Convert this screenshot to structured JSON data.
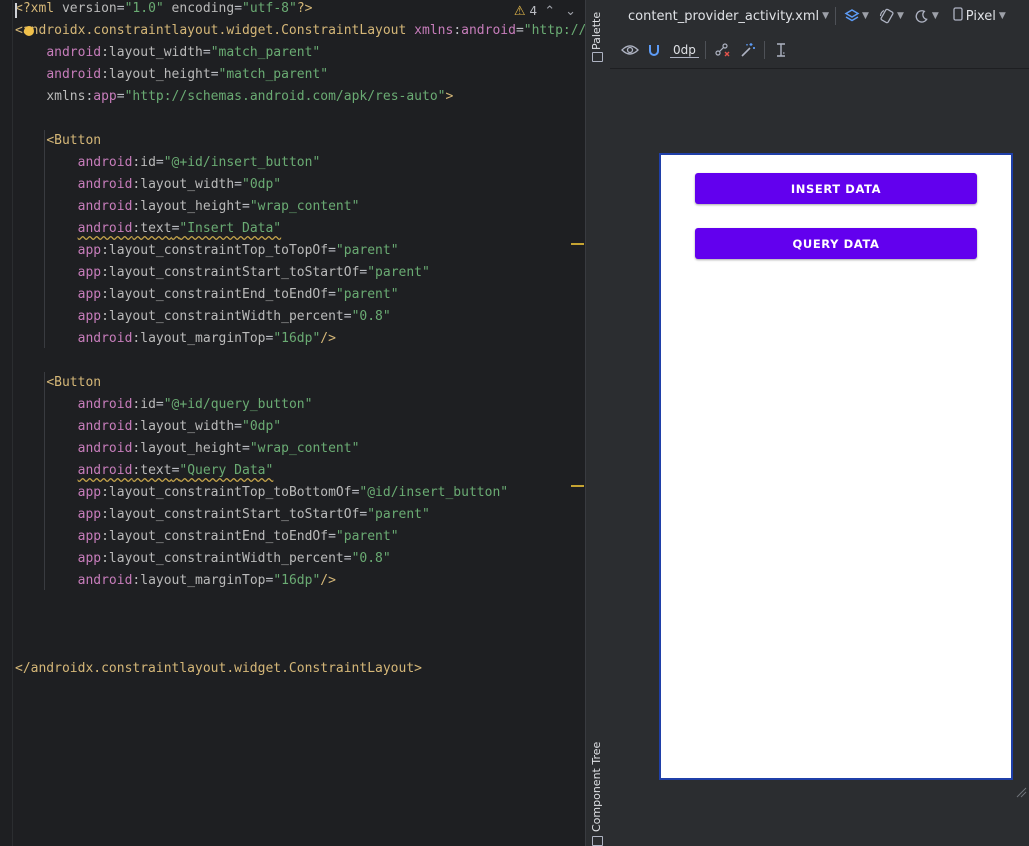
{
  "editor": {
    "warnings": {
      "count": "4"
    },
    "lines": [
      {
        "p": [
          {
            "c": "tag",
            "t": "<?xml "
          },
          {
            "c": "attr",
            "t": "version"
          },
          {
            "c": "plain",
            "t": "="
          },
          {
            "c": "val",
            "t": "\"1.0\""
          },
          {
            "c": "attr",
            "t": " encoding"
          },
          {
            "c": "plain",
            "t": "="
          },
          {
            "c": "val",
            "t": "\"utf-8\""
          },
          {
            "c": "tag",
            "t": "?>"
          }
        ]
      },
      {
        "p": [
          {
            "c": "tag",
            "t": "<androidx.constraintlayout.widget.ConstraintLayout "
          },
          {
            "c": "ns",
            "t": "xmlns"
          },
          {
            "c": "plain",
            "t": ":"
          },
          {
            "c": "ns",
            "t": "android"
          },
          {
            "c": "plain",
            "t": "="
          },
          {
            "c": "val",
            "t": "\"http://schemas.android.com/apk/res/android\""
          }
        ]
      },
      {
        "p": [
          {
            "c": "plain",
            "t": "    "
          },
          {
            "c": "ns",
            "t": "android"
          },
          {
            "c": "attr",
            "t": ":layout_width"
          },
          {
            "c": "plain",
            "t": "="
          },
          {
            "c": "val",
            "t": "\"match_parent\""
          }
        ]
      },
      {
        "p": [
          {
            "c": "plain",
            "t": "    "
          },
          {
            "c": "ns",
            "t": "android"
          },
          {
            "c": "attr",
            "t": ":layout_height"
          },
          {
            "c": "plain",
            "t": "="
          },
          {
            "c": "val",
            "t": "\"match_parent\""
          }
        ]
      },
      {
        "p": [
          {
            "c": "plain",
            "t": "    "
          },
          {
            "c": "attr",
            "t": "xmlns"
          },
          {
            "c": "plain",
            "t": ":"
          },
          {
            "c": "ns",
            "t": "app"
          },
          {
            "c": "plain",
            "t": "="
          },
          {
            "c": "val",
            "t": "\"http://schemas.android.com/apk/res-auto\""
          },
          {
            "c": "tag",
            "t": ">"
          }
        ]
      },
      {
        "p": []
      },
      {
        "p": [
          {
            "c": "plain",
            "t": "    "
          },
          {
            "c": "tag",
            "t": "<Button"
          }
        ]
      },
      {
        "p": [
          {
            "c": "plain",
            "t": "        "
          },
          {
            "c": "ns",
            "t": "android"
          },
          {
            "c": "attr",
            "t": ":id"
          },
          {
            "c": "plain",
            "t": "="
          },
          {
            "c": "val",
            "t": "\"@+id/insert_button\""
          }
        ]
      },
      {
        "p": [
          {
            "c": "plain",
            "t": "        "
          },
          {
            "c": "ns",
            "t": "android"
          },
          {
            "c": "attr",
            "t": ":layout_width"
          },
          {
            "c": "plain",
            "t": "="
          },
          {
            "c": "val",
            "t": "\"0dp\""
          }
        ]
      },
      {
        "p": [
          {
            "c": "plain",
            "t": "        "
          },
          {
            "c": "ns",
            "t": "android"
          },
          {
            "c": "attr",
            "t": ":layout_height"
          },
          {
            "c": "plain",
            "t": "="
          },
          {
            "c": "val",
            "t": "\"wrap_content\""
          }
        ]
      },
      {
        "p": [
          {
            "c": "plain",
            "t": "        "
          },
          {
            "c": "ns wavy",
            "t": "android"
          },
          {
            "c": "attr wavy",
            "t": ":text"
          },
          {
            "c": "plain wavy",
            "t": "="
          },
          {
            "c": "val wavy",
            "t": "\"Insert Data\""
          }
        ]
      },
      {
        "p": [
          {
            "c": "plain",
            "t": "        "
          },
          {
            "c": "ns",
            "t": "app"
          },
          {
            "c": "attr",
            "t": ":layout_constraintTop_toTopOf"
          },
          {
            "c": "plain",
            "t": "="
          },
          {
            "c": "val",
            "t": "\"parent\""
          }
        ]
      },
      {
        "p": [
          {
            "c": "plain",
            "t": "        "
          },
          {
            "c": "ns",
            "t": "app"
          },
          {
            "c": "attr",
            "t": ":layout_constraintStart_toStartOf"
          },
          {
            "c": "plain",
            "t": "="
          },
          {
            "c": "val",
            "t": "\"parent\""
          }
        ]
      },
      {
        "p": [
          {
            "c": "plain",
            "t": "        "
          },
          {
            "c": "ns",
            "t": "app"
          },
          {
            "c": "attr",
            "t": ":layout_constraintEnd_toEndOf"
          },
          {
            "c": "plain",
            "t": "="
          },
          {
            "c": "val",
            "t": "\"parent\""
          }
        ]
      },
      {
        "p": [
          {
            "c": "plain",
            "t": "        "
          },
          {
            "c": "ns",
            "t": "app"
          },
          {
            "c": "attr",
            "t": ":layout_constraintWidth_percent"
          },
          {
            "c": "plain",
            "t": "="
          },
          {
            "c": "val",
            "t": "\"0.8\""
          }
        ]
      },
      {
        "p": [
          {
            "c": "plain",
            "t": "        "
          },
          {
            "c": "ns",
            "t": "android"
          },
          {
            "c": "attr",
            "t": ":layout_marginTop"
          },
          {
            "c": "plain",
            "t": "="
          },
          {
            "c": "val",
            "t": "\"16dp\""
          },
          {
            "c": "tag",
            "t": "/>"
          }
        ]
      },
      {
        "p": []
      },
      {
        "p": [
          {
            "c": "plain",
            "t": "    "
          },
          {
            "c": "tag",
            "t": "<Button"
          }
        ]
      },
      {
        "p": [
          {
            "c": "plain",
            "t": "        "
          },
          {
            "c": "ns",
            "t": "android"
          },
          {
            "c": "attr",
            "t": ":id"
          },
          {
            "c": "plain",
            "t": "="
          },
          {
            "c": "val",
            "t": "\"@+id/query_button\""
          }
        ]
      },
      {
        "p": [
          {
            "c": "plain",
            "t": "        "
          },
          {
            "c": "ns",
            "t": "android"
          },
          {
            "c": "attr",
            "t": ":layout_width"
          },
          {
            "c": "plain",
            "t": "="
          },
          {
            "c": "val",
            "t": "\"0dp\""
          }
        ]
      },
      {
        "p": [
          {
            "c": "plain",
            "t": "        "
          },
          {
            "c": "ns",
            "t": "android"
          },
          {
            "c": "attr",
            "t": ":layout_height"
          },
          {
            "c": "plain",
            "t": "="
          },
          {
            "c": "val",
            "t": "\"wrap_content\""
          }
        ]
      },
      {
        "p": [
          {
            "c": "plain",
            "t": "        "
          },
          {
            "c": "ns wavy",
            "t": "android"
          },
          {
            "c": "attr wavy",
            "t": ":text"
          },
          {
            "c": "plain wavy",
            "t": "="
          },
          {
            "c": "val wavy",
            "t": "\"Query Data\""
          }
        ]
      },
      {
        "p": [
          {
            "c": "plain",
            "t": "        "
          },
          {
            "c": "ns",
            "t": "app"
          },
          {
            "c": "attr",
            "t": ":layout_constraintTop_toBottomOf"
          },
          {
            "c": "plain",
            "t": "="
          },
          {
            "c": "val",
            "t": "\"@id/insert_button\""
          }
        ]
      },
      {
        "p": [
          {
            "c": "plain",
            "t": "        "
          },
          {
            "c": "ns",
            "t": "app"
          },
          {
            "c": "attr",
            "t": ":layout_constraintStart_toStartOf"
          },
          {
            "c": "plain",
            "t": "="
          },
          {
            "c": "val",
            "t": "\"parent\""
          }
        ]
      },
      {
        "p": [
          {
            "c": "plain",
            "t": "        "
          },
          {
            "c": "ns",
            "t": "app"
          },
          {
            "c": "attr",
            "t": ":layout_constraintEnd_toEndOf"
          },
          {
            "c": "plain",
            "t": "="
          },
          {
            "c": "val",
            "t": "\"parent\""
          }
        ]
      },
      {
        "p": [
          {
            "c": "plain",
            "t": "        "
          },
          {
            "c": "ns",
            "t": "app"
          },
          {
            "c": "attr",
            "t": ":layout_constraintWidth_percent"
          },
          {
            "c": "plain",
            "t": "="
          },
          {
            "c": "val",
            "t": "\"0.8\""
          }
        ]
      },
      {
        "p": [
          {
            "c": "plain",
            "t": "        "
          },
          {
            "c": "ns",
            "t": "android"
          },
          {
            "c": "attr",
            "t": ":layout_marginTop"
          },
          {
            "c": "plain",
            "t": "="
          },
          {
            "c": "val",
            "t": "\"16dp\""
          },
          {
            "c": "tag",
            "t": "/>"
          }
        ]
      },
      {
        "p": []
      },
      {
        "p": []
      },
      {
        "p": []
      },
      {
        "p": [
          {
            "c": "tag",
            "t": "</androidx.constraintlayout.widget.ConstraintLayout>"
          }
        ]
      }
    ]
  },
  "side_strip": {
    "palette_label": "Palette",
    "component_tree_label": "Component Tree"
  },
  "design": {
    "file_name": "content_provider_activity.xml",
    "device_name": "Pixel",
    "default_margin": "0dp",
    "icons": {
      "file_dropdown": "chevron-down-icon",
      "design_surface": "layers-icon",
      "orientation": "rotate-icon",
      "night_mode": "moon-icon",
      "device": "phone-icon",
      "view_options": "eye-icon",
      "autoconnect": "magnet-icon",
      "clear_constraints": "clear-constraints-icon",
      "infer_constraints": "magic-wand-icon",
      "guidelines": "guideline-icon"
    },
    "preview": {
      "insert_button": "INSERT DATA",
      "query_button": "QUERY DATA"
    },
    "colors": {
      "button": "#6200ee",
      "button_text": "#ffffff",
      "device_border": "#1f3fa8"
    }
  }
}
